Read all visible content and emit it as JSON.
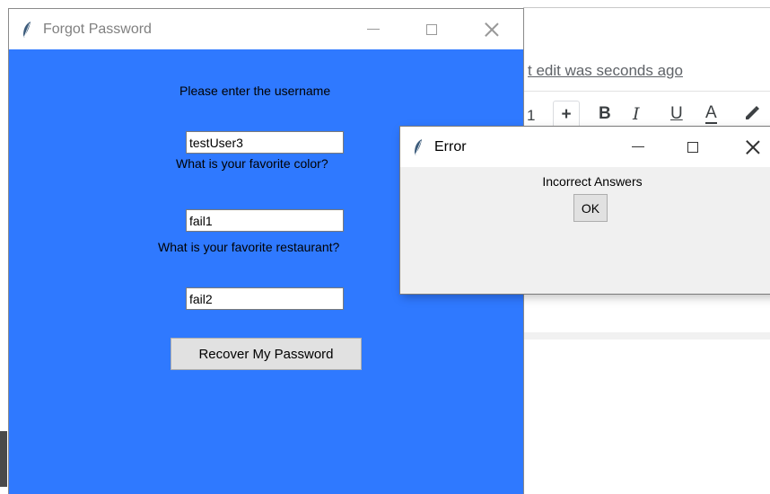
{
  "background_editor": {
    "last_edit_text": "t edit was seconds ago",
    "toolbar": {
      "font_size": "1",
      "plus": "+",
      "bold": "B",
      "italic": "I",
      "underline": "U",
      "text_color": "A",
      "highlight_icon": "pen-icon"
    }
  },
  "forgot_window": {
    "title": "Forgot Password",
    "username_prompt": "Please enter the username",
    "username_value": "testUser3",
    "color_question": "What is your favorite color?",
    "color_answer": "fail1",
    "restaurant_question": "What is your favorite restaurant?",
    "restaurant_answer": "fail2",
    "recover_button": "Recover My Password",
    "background_color": "#2f79ff"
  },
  "error_dialog": {
    "title": "Error",
    "message": "Incorrect Answers",
    "ok_button": "OK"
  }
}
